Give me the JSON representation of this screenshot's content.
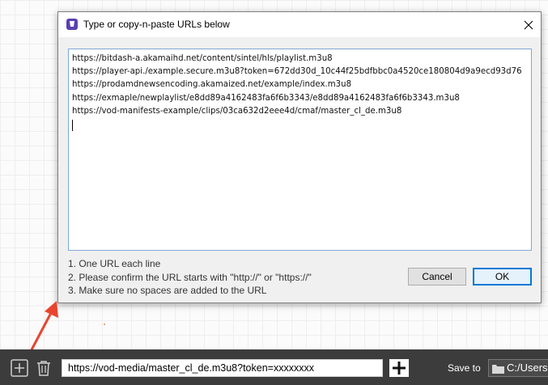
{
  "dialog": {
    "title": "Type or copy-n-paste URLs below",
    "urls": [
      "https://bitdash-a.akamaihd.net/content/sintel/hls/playlist.m3u8",
      "https://player-api./example.secure.m3u8?token=672dd30d_10c44f25bdfbbc0a4520ce180804d9a9ecd93d76",
      "https://prodamdnewsencoding.akamaized.net/example/index.m3u8",
      "https://exmaple/newplaylist/e8dd89a4162483fa6f6b3343/e8dd89a4162483fa6f6b3343.m3u8",
      "https://vod-manifests-example/clips/03ca632d2eee4d/cmaf/master_cl_de.m3u8"
    ],
    "instructions": [
      "1. One URL each line",
      "2. Please confirm the URL starts with \"http://\" or \"https://\"",
      "3. Make sure no spaces are added to the URL"
    ],
    "cancel_label": "Cancel",
    "ok_label": "OK"
  },
  "bottom_bar": {
    "url_value": "https://vod-media/master_cl_de.m3u8?token=xxxxxxxx",
    "save_to_label": "Save to",
    "path_value": "C:/Users"
  },
  "colors": {
    "accent": "#0078d7",
    "arrow": "#e8452e",
    "bottom_bar": "#3c3c3c"
  },
  "icons": [
    "app-icon",
    "close-icon",
    "add-icon",
    "trash-icon",
    "plus-icon",
    "folder-icon",
    "annotation-arrow"
  ]
}
